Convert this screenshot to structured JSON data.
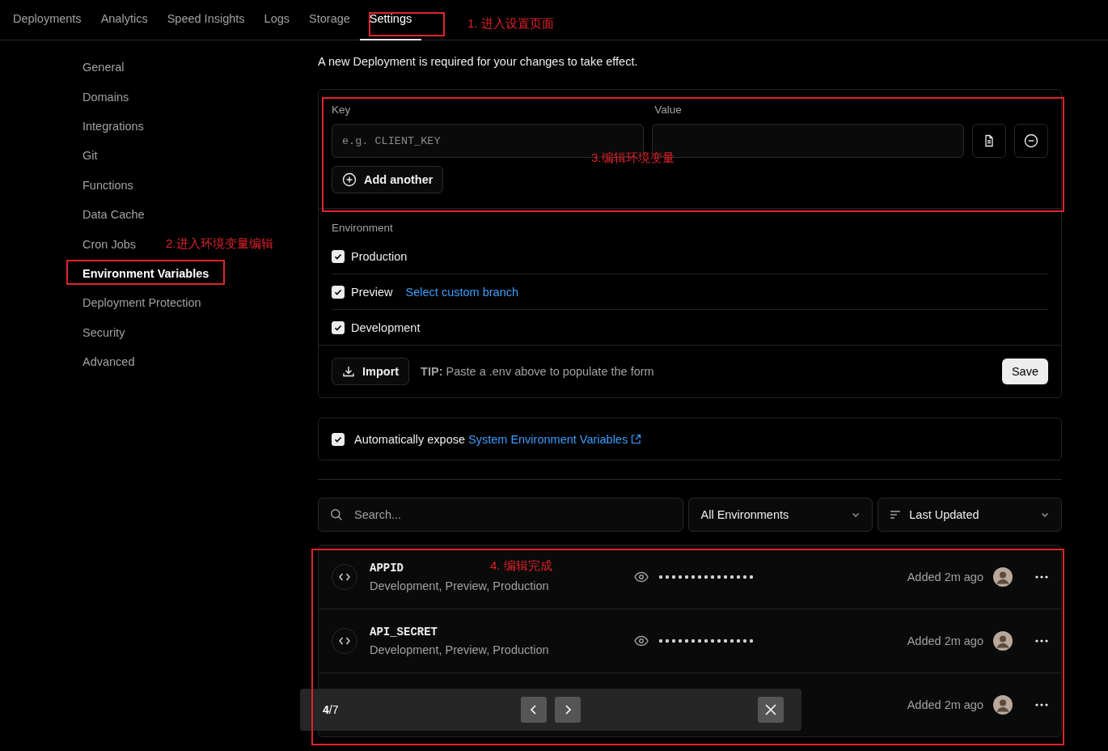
{
  "nav": {
    "tabs": [
      {
        "label": "Deployments",
        "selected": false
      },
      {
        "label": "Analytics",
        "selected": false
      },
      {
        "label": "Speed Insights",
        "selected": false
      },
      {
        "label": "Logs",
        "selected": false
      },
      {
        "label": "Storage",
        "selected": false
      },
      {
        "label": "Settings",
        "selected": true
      }
    ]
  },
  "sidebar": {
    "items": [
      {
        "label": "General",
        "selected": false
      },
      {
        "label": "Domains",
        "selected": false
      },
      {
        "label": "Integrations",
        "selected": false
      },
      {
        "label": "Git",
        "selected": false
      },
      {
        "label": "Functions",
        "selected": false
      },
      {
        "label": "Data Cache",
        "selected": false
      },
      {
        "label": "Cron Jobs",
        "selected": false
      },
      {
        "label": "Environment Variables",
        "selected": true
      },
      {
        "label": "Deployment Protection",
        "selected": false
      },
      {
        "label": "Security",
        "selected": false
      },
      {
        "label": "Advanced",
        "selected": false
      }
    ]
  },
  "notice": "A new Deployment is required for your changes to take effect.",
  "form": {
    "key_label": "Key",
    "key_placeholder": "e.g. CLIENT_KEY",
    "value_label": "Value",
    "add_button": "Add another",
    "environment_label": "Environment",
    "environments": [
      {
        "label": "Production",
        "checked": true
      },
      {
        "label": "Preview",
        "checked": true,
        "link": "Select custom branch"
      },
      {
        "label": "Development",
        "checked": true
      }
    ],
    "import_button": "Import",
    "tip": "**TIP:** Paste a .env above to populate the form",
    "save_button": "Save"
  },
  "expose": {
    "checked": true,
    "text": "Automatically expose",
    "link": "System Environment Variables"
  },
  "filters": {
    "search_placeholder": "Search...",
    "environment_select": "All Environments",
    "sort_select": "Last Updated"
  },
  "variables": [
    {
      "name": "APPID",
      "environments": "Development, Preview, Production",
      "added": "Added 2m ago"
    },
    {
      "name": "API_SECRET",
      "environments": "Development, Preview, Production",
      "added": "Added 2m ago"
    },
    {
      "added": "Added 2m ago"
    }
  ],
  "viewer": {
    "counter": "**4**/7"
  },
  "annotations": [
    "1. 进入设置页面",
    "2.进入环境变量编辑",
    "3.编辑环境变量",
    "4. 编辑完成"
  ]
}
